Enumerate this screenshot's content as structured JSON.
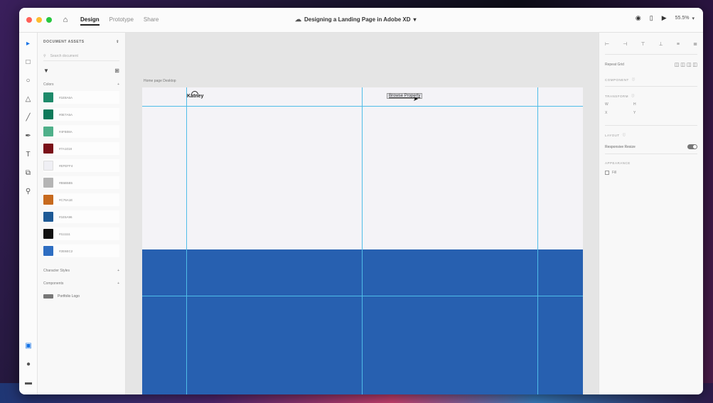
{
  "window": {
    "title": "Designing a Landing Page in Adobe XD",
    "mode_tabs": [
      "Design",
      "Prototype",
      "Share"
    ],
    "active_tab": "Design",
    "zoom": "55.5%"
  },
  "left_panel": {
    "header": "DOCUMENT ASSETS",
    "search_placeholder": "Search document",
    "colors_section": "Colors",
    "colors": [
      {
        "hex": "#1e8a6a",
        "label": "#1E8A6A"
      },
      {
        "hex": "#0e7a5a",
        "label": "#0E7A5A"
      },
      {
        "hex": "#4fb08a",
        "label": "#4FB08A"
      },
      {
        "hex": "#7a1018",
        "label": "#7A1018"
      },
      {
        "hex": "#efeff4",
        "label": "#EFEFF4"
      },
      {
        "hex": "#b5b5b5",
        "label": "#B5B5B5"
      },
      {
        "hex": "#c76a1e",
        "label": "#C76A1E"
      },
      {
        "hex": "#1e5a96",
        "label": "#1E5A96"
      },
      {
        "hex": "#111111",
        "label": "#111111"
      },
      {
        "hex": "#2e6ec2",
        "label": "#2E6EC2"
      }
    ],
    "character_styles": "Character Styles",
    "components": "Components",
    "component_item": "Portfolio Logo"
  },
  "canvas": {
    "artboard_label": "Home page Desktop",
    "logo_text": "Katney",
    "browse_link": "Browse Property",
    "footer_color": "#2760b0",
    "guide_color": "#4fbde8"
  },
  "right_panel": {
    "component_label": "COMPONENT",
    "transform_label": "TRANSFORM",
    "layout_label": "LAYOUT",
    "responsive_resize": "Responsive Resize",
    "appearance_label": "APPEARANCE",
    "fill_label": "Fill",
    "repeat_grid": "Repeat Grid",
    "fields": [
      "W",
      "H",
      "X",
      "Y"
    ]
  }
}
